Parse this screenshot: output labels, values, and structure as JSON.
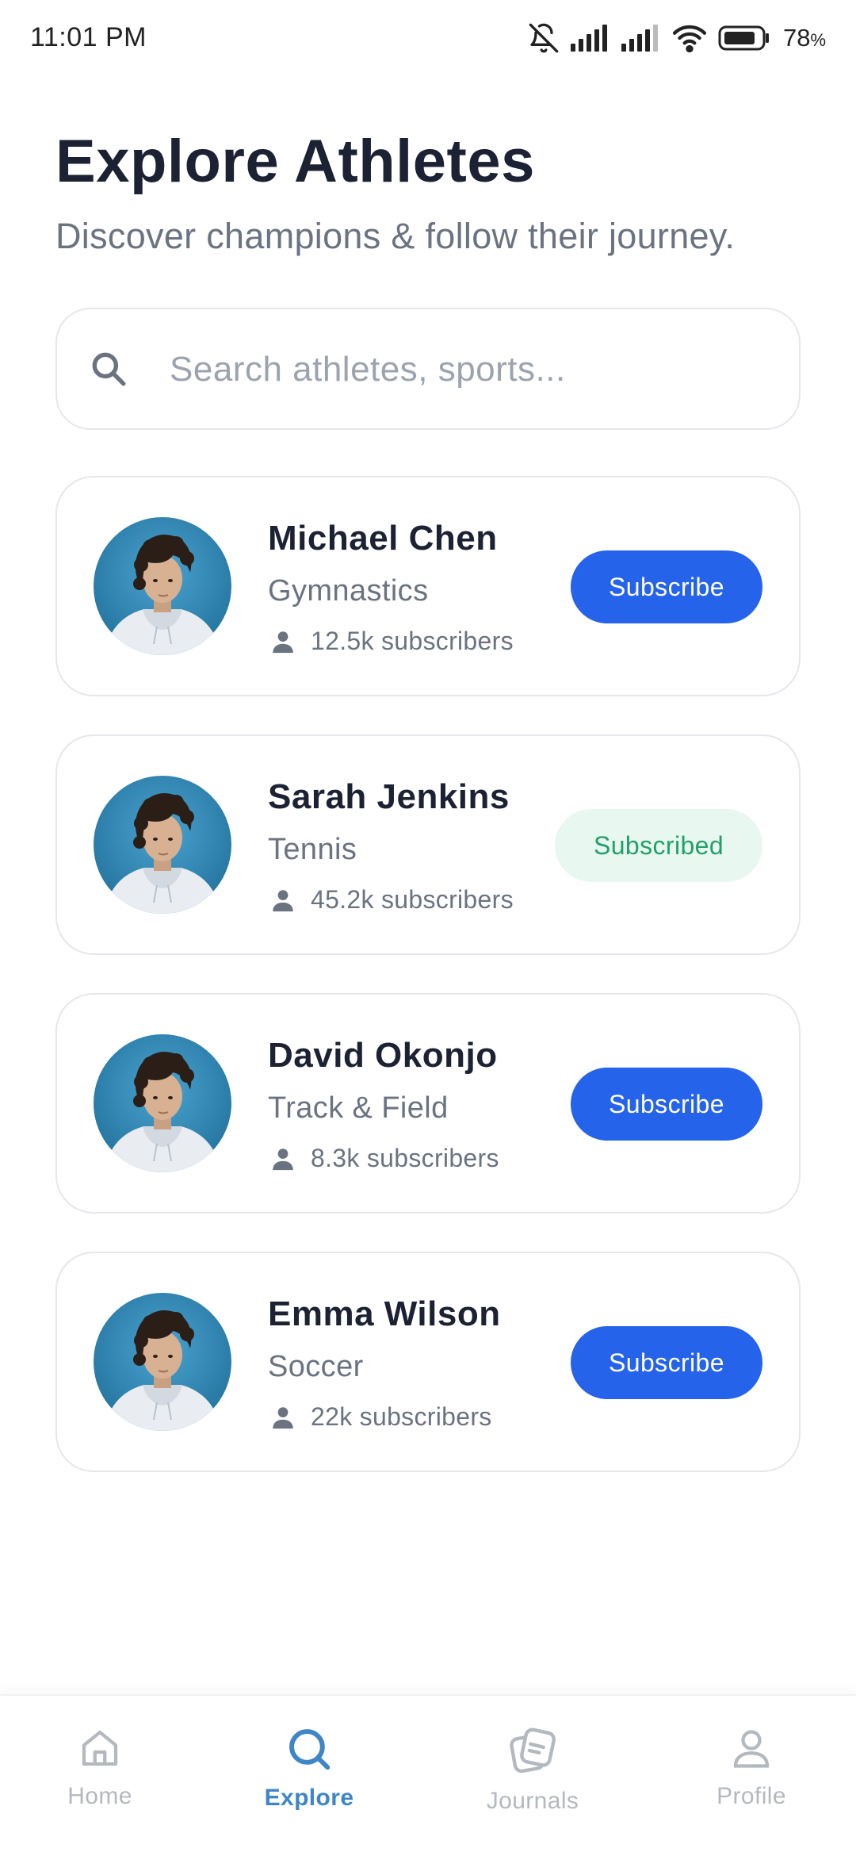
{
  "status_bar": {
    "time": "11:01 PM",
    "battery_percent": "78",
    "battery_unit": "%",
    "icons": [
      "bell-off-icon",
      "signal-icon",
      "signal-icon",
      "wifi-icon",
      "battery-icon"
    ]
  },
  "header": {
    "title": "Explore Athletes",
    "subtitle": "Discover champions & follow their journey."
  },
  "search": {
    "placeholder": "Search athletes, sports...",
    "value": "",
    "icon": "search-icon"
  },
  "athletes": [
    {
      "name": "Michael Chen",
      "sport": "Gymnastics",
      "subscribers": "12.5k subscribers",
      "button_label": "Subscribe",
      "subscribed": false
    },
    {
      "name": "Sarah Jenkins",
      "sport": "Tennis",
      "subscribers": "45.2k subscribers",
      "button_label": "Subscribed",
      "subscribed": true
    },
    {
      "name": "David Okonjo",
      "sport": "Track & Field",
      "subscribers": "8.3k subscribers",
      "button_label": "Subscribe",
      "subscribed": false
    },
    {
      "name": "Emma Wilson",
      "sport": "Soccer",
      "subscribers": "22k subscribers",
      "button_label": "Subscribe",
      "subscribed": false
    }
  ],
  "bottom_nav": {
    "active": "Explore",
    "items": [
      {
        "label": "Home",
        "icon": "home-icon"
      },
      {
        "label": "Explore",
        "icon": "search-icon"
      },
      {
        "label": "Journals",
        "icon": "journal-icon"
      },
      {
        "label": "Profile",
        "icon": "user-icon"
      }
    ]
  },
  "colors": {
    "primary": "#2563eb",
    "subscribed_bg": "#e8f7f0",
    "subscribed_text": "#22a06b",
    "nav_active": "#3f86c8",
    "nav_inactive": "#b4b8bf",
    "title": "#1c2233",
    "muted": "#6b7280"
  }
}
